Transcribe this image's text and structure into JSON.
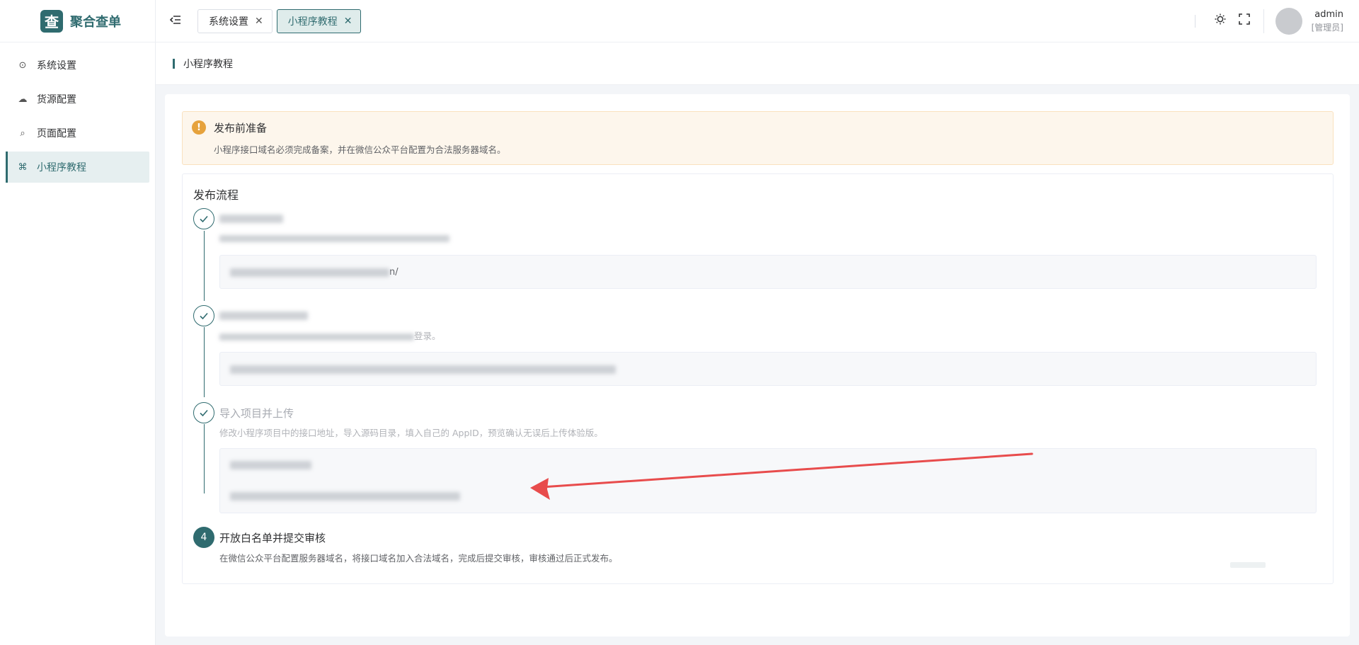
{
  "brand": {
    "logo_glyph": "查",
    "name": "聚合查单"
  },
  "sidebar": {
    "items": [
      {
        "label": "系统设置",
        "icon": "settings-icon",
        "active": false
      },
      {
        "label": "货源配置",
        "icon": "cloud-icon",
        "active": false
      },
      {
        "label": "页面配置",
        "icon": "search-icon",
        "active": false
      },
      {
        "label": "小程序教程",
        "icon": "command-icon",
        "active": true
      }
    ]
  },
  "header": {
    "tabs": [
      {
        "label": "系统设置",
        "active": false
      },
      {
        "label": "小程序教程",
        "active": true
      }
    ],
    "user": {
      "name": "admin",
      "role": "[管理员]"
    }
  },
  "breadcrumb": {
    "title": "小程序教程"
  },
  "notice": {
    "title": "发布前准备",
    "desc": "小程序接口域名必须完成备案，并在微信公众平台配置为合法服务器域名。"
  },
  "flow": {
    "title": "发布流程",
    "steps": [
      {
        "title": "",
        "desc": "",
        "code": [
          "n/"
        ]
      },
      {
        "title": "",
        "desc": "登录。",
        "code": [
          ""
        ]
      },
      {
        "title": "导入项目并上传",
        "desc": "修改小程序项目中的接口地址，导入源码目录，填入自己的 AppID，预览确认无误后上传体验版。",
        "code": [
          "",
          ""
        ]
      },
      {
        "number": "4",
        "title": "开放白名单并提交审核",
        "desc": "在微信公众平台配置服务器域名，将接口域名加入合法域名，完成后提交审核，审核通过后正式发布。"
      }
    ]
  },
  "colors": {
    "accent": "#2f6b6f",
    "warning": "#e6a23c",
    "annotation_arrow": "#e84c4c"
  }
}
